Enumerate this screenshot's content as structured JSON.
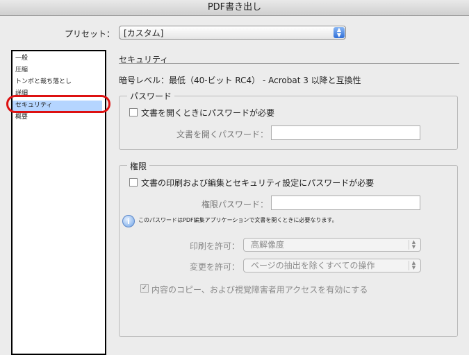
{
  "window": {
    "title": "PDF書き出し"
  },
  "preset": {
    "label": "プリセット：",
    "value": "[カスタム]"
  },
  "sidebar": {
    "items": [
      {
        "label": "一般"
      },
      {
        "label": "圧縮"
      },
      {
        "label": "トンボと裁ち落とし"
      },
      {
        "label": "詳細"
      },
      {
        "label": "セキュリティ",
        "selected": true
      },
      {
        "label": "概要"
      }
    ]
  },
  "security": {
    "title": "セキュリティ",
    "encryption_level": "暗号レベル：最低（40-ビット RC4） - Acrobat 3 以降と互換性",
    "password_group": {
      "title": "パスワード",
      "require_open_password": {
        "label": "文書を開くときにパスワードが必要",
        "checked": false
      },
      "open_password": {
        "label": "文書を開くパスワード：",
        "value": ""
      }
    },
    "permissions_group": {
      "title": "権限",
      "require_permission_password": {
        "label": "文書の印刷および編集とセキュリティ設定にパスワードが必要",
        "checked": false
      },
      "permissions_password": {
        "label": "権限パスワード：",
        "value": ""
      },
      "info_text": "このパスワードはPDF編集アプリケーションで文書を開くときに必要なります。",
      "printing_allowed": {
        "label": "印刷を許可：",
        "value": "高解像度"
      },
      "changes_allowed": {
        "label": "変更を許可：",
        "value": "ページの抽出を除くすべての操作"
      },
      "enable_copy": {
        "label": "内容のコピー、および視覚障害者用アクセスを有効にする",
        "checked": true
      }
    }
  }
}
